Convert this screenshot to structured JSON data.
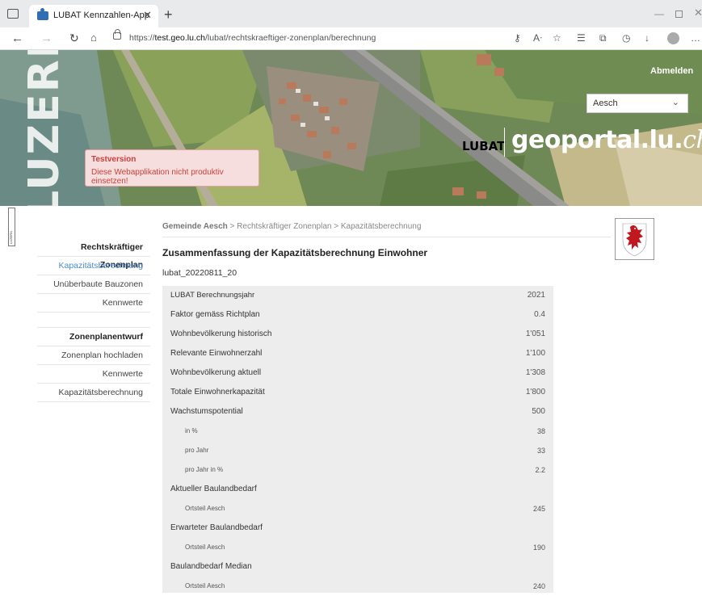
{
  "browser": {
    "tab_title": "LUBAT Kennzahlen-App",
    "url_prefix": "https://",
    "url_host": "test.geo.lu.ch",
    "url_path": "/lubat/rechtskraeftiger-zonenplan/berechnung"
  },
  "header": {
    "luzern_word": "LUZERN",
    "logout_label": "Abmelden",
    "gemeinde_select_value": "Aesch",
    "lubat_logo": "LUBAT",
    "geoportal_logo": "geoportal.lu.",
    "geoportal_ch": "ch",
    "test_title": "Testversion",
    "test_message": "Diese Webapplikation nicht produktiv einsetzen!"
  },
  "side_flag_text": "LUZERN",
  "sidebar": {
    "section1": "Rechtskräftiger Zonenplan",
    "s1_items": [
      "Kapazitätsberechnung",
      "Unüberbaute Bauzonen",
      "Kennwerte"
    ],
    "section2": "Zonenplanentwurf",
    "s2_items": [
      "Zonenplan hochladen",
      "Kennwerte",
      "Kapazitätsberechnung"
    ]
  },
  "breadcrumb": {
    "gemeinde": "Gemeinde Aesch",
    "rest": " > Rechtskräftiger Zonenplan > Kapazitätsberechnung"
  },
  "page_title": "Zusammenfassung der Kapazitätsberechnung Einwohner",
  "calc_id": "lubat_20220811_20",
  "table": {
    "rows": [
      {
        "label": "LUBAT Berechnungsjahr",
        "value": "2021"
      },
      {
        "label": "Faktor gemäss Richtplan",
        "value": "0.4"
      },
      {
        "label": "Wohnbevölkerung historisch",
        "value": "1'051"
      },
      {
        "label": "Relevante Einwohnerzahl",
        "value": "1'100"
      },
      {
        "label": "Wohnbevölkerung aktuell",
        "value": "1'308"
      },
      {
        "label": "Totale Einwohnerkapazität",
        "value": "1'800"
      },
      {
        "label": "Wachstumspotential",
        "value": "500"
      },
      {
        "label": "in %",
        "value": "38"
      },
      {
        "label": "pro Jahr",
        "value": "33"
      },
      {
        "label": "pro Jahr in %",
        "value": "2.2"
      },
      {
        "label": "Aktueller Baulandbedarf",
        "value": ""
      },
      {
        "label": "Ortsteil Aesch",
        "value": "245"
      },
      {
        "label": "Erwarteter Baulandbedarf",
        "value": ""
      },
      {
        "label": "Ortsteil Aesch",
        "value": "190"
      },
      {
        "label": "Baulandbedarf Median",
        "value": ""
      },
      {
        "label": "Ortsteil Aesch",
        "value": "240"
      }
    ]
  },
  "colors": {
    "accent_link": "#4a8ad1",
    "test_box_bg": "#f6dede",
    "test_box_text": "#c9423c",
    "table_bg": "#ededed"
  }
}
